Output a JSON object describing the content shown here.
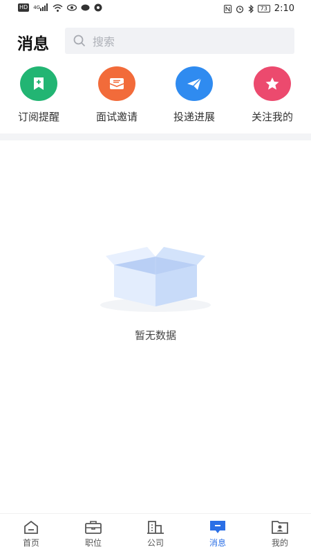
{
  "status_bar": {
    "left_icons": [
      "hd-icon",
      "4g-signal-icon",
      "wifi-icon",
      "eye-icon",
      "message-icon",
      "app-icon"
    ],
    "network_text": "4G",
    "hd_text": "HD",
    "battery": "73",
    "time": "2:10"
  },
  "header": {
    "title": "消息",
    "search_placeholder": "搜索"
  },
  "quick_actions": [
    {
      "label": "订阅提醒",
      "icon": "bookmark-plus-icon",
      "color": "#22b573"
    },
    {
      "label": "面试邀请",
      "icon": "mail-icon",
      "color": "#f26b3a"
    },
    {
      "label": "投递进展",
      "icon": "paper-plane-icon",
      "color": "#2f8bf0"
    },
    {
      "label": "关注我的",
      "icon": "star-icon",
      "color": "#ec4a6e"
    }
  ],
  "empty_state": {
    "text": "暂无数据"
  },
  "tabbar": [
    {
      "label": "首页",
      "icon": "home-icon",
      "active": false
    },
    {
      "label": "职位",
      "icon": "briefcase-icon",
      "active": false
    },
    {
      "label": "公司",
      "icon": "building-icon",
      "active": false
    },
    {
      "label": "消息",
      "icon": "message-icon",
      "active": true
    },
    {
      "label": "我的",
      "icon": "profile-folder-icon",
      "active": false
    }
  ],
  "colors": {
    "accent": "#2b6fe6"
  }
}
